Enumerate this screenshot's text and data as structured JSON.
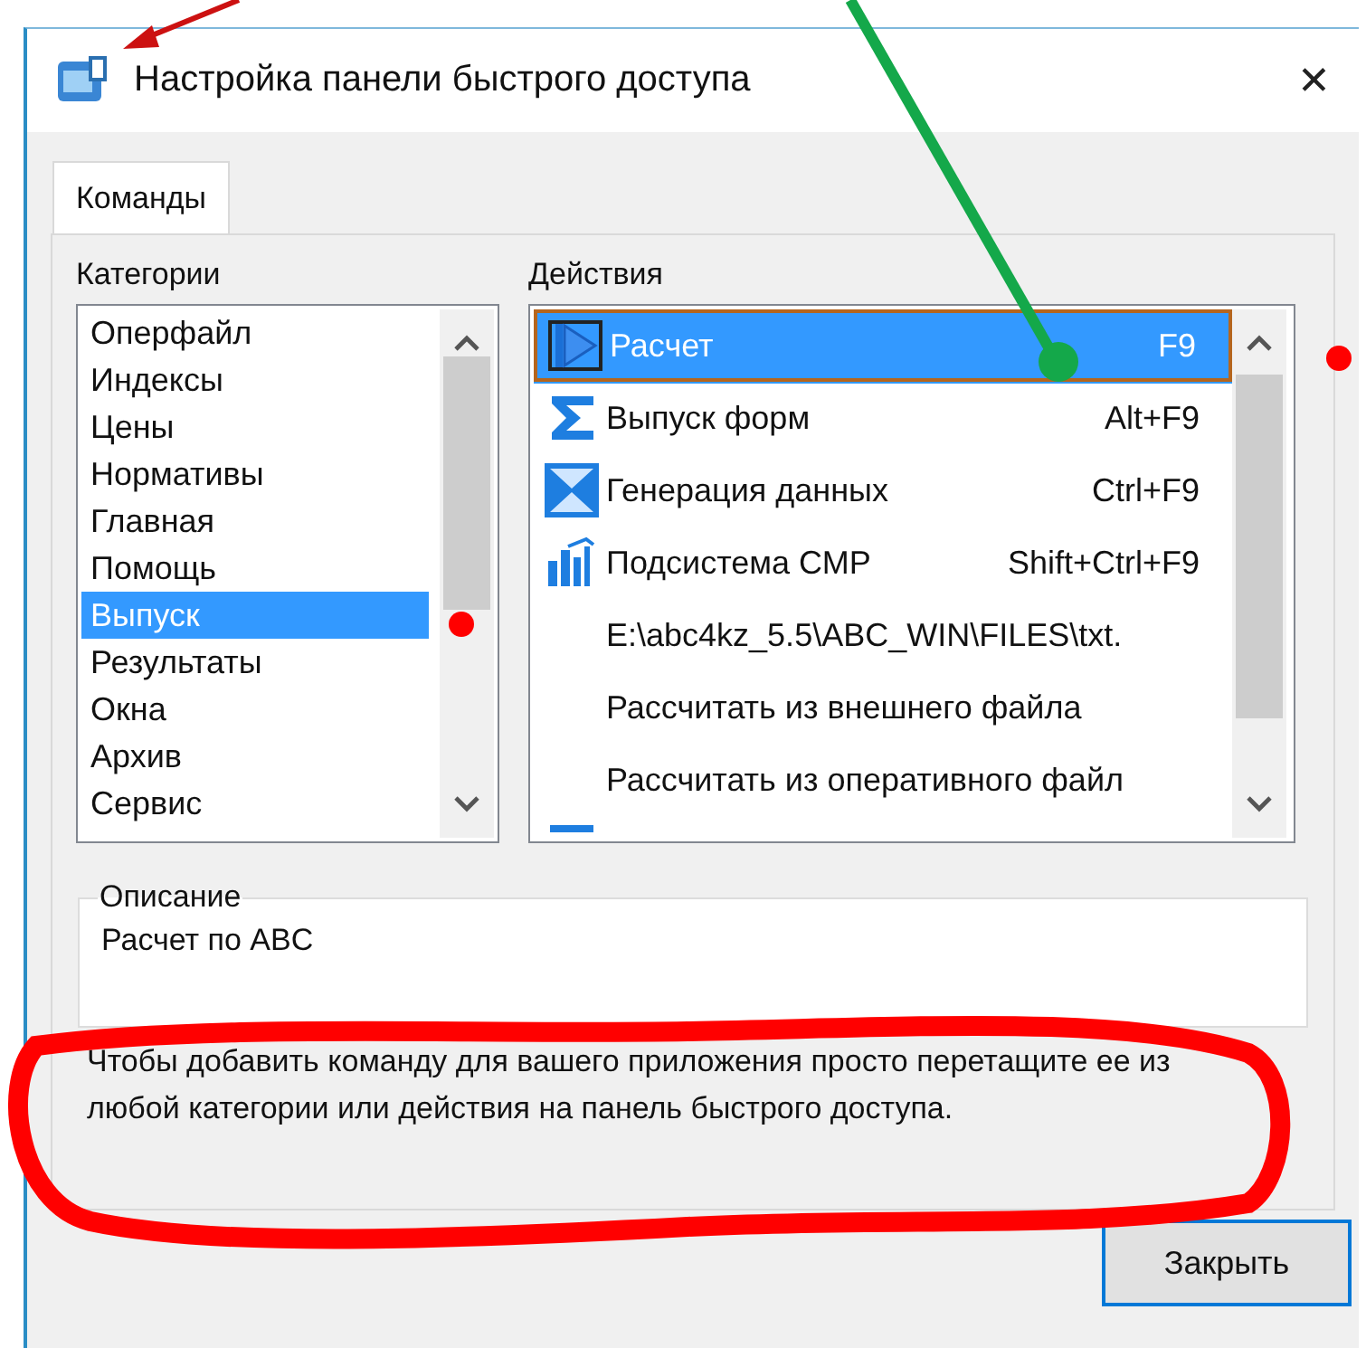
{
  "window": {
    "title": "Настройка панели быстрого доступа",
    "close": "✕"
  },
  "tabs": [
    {
      "label": "Команды",
      "selected": true
    }
  ],
  "categories": {
    "label": "Категории",
    "items": [
      {
        "label": "Оперфайл",
        "selected": false
      },
      {
        "label": "Индексы",
        "selected": false
      },
      {
        "label": "Цены",
        "selected": false
      },
      {
        "label": "Нормативы",
        "selected": false
      },
      {
        "label": "Главная",
        "selected": false
      },
      {
        "label": "Помощь",
        "selected": false
      },
      {
        "label": "Выпуск",
        "selected": true
      },
      {
        "label": "Результаты",
        "selected": false
      },
      {
        "label": "Окна",
        "selected": false
      },
      {
        "label": "Архив",
        "selected": false
      },
      {
        "label": "Сервис",
        "selected": false
      }
    ]
  },
  "actions": {
    "label": "Действия",
    "items": [
      {
        "label": "Расчет",
        "shortcut": "F9",
        "selected": true
      },
      {
        "label": "Выпуск форм",
        "shortcut": "Alt+F9",
        "selected": false
      },
      {
        "label": "Генерация данных",
        "shortcut": "Ctrl+F9",
        "selected": false
      },
      {
        "label": "Подсистема СМР",
        "shortcut": "Shift+Ctrl+F9",
        "selected": false
      },
      {
        "label": "E:\\abc4kz_5.5\\ABC_WIN\\FILES\\txt.",
        "selected": false
      },
      {
        "label": "Рассчитать из внешнего файла",
        "selected": false
      },
      {
        "label": "Рассчитать из оперативного файл",
        "selected": false
      }
    ]
  },
  "description": {
    "label": "Описание",
    "text": "Расчет по ABC"
  },
  "help_text": "Чтобы добавить команду для вашего приложения просто перетащите ее из любой категории или действия на панель быстрого доступа.",
  "close_button": "Закрыть"
}
